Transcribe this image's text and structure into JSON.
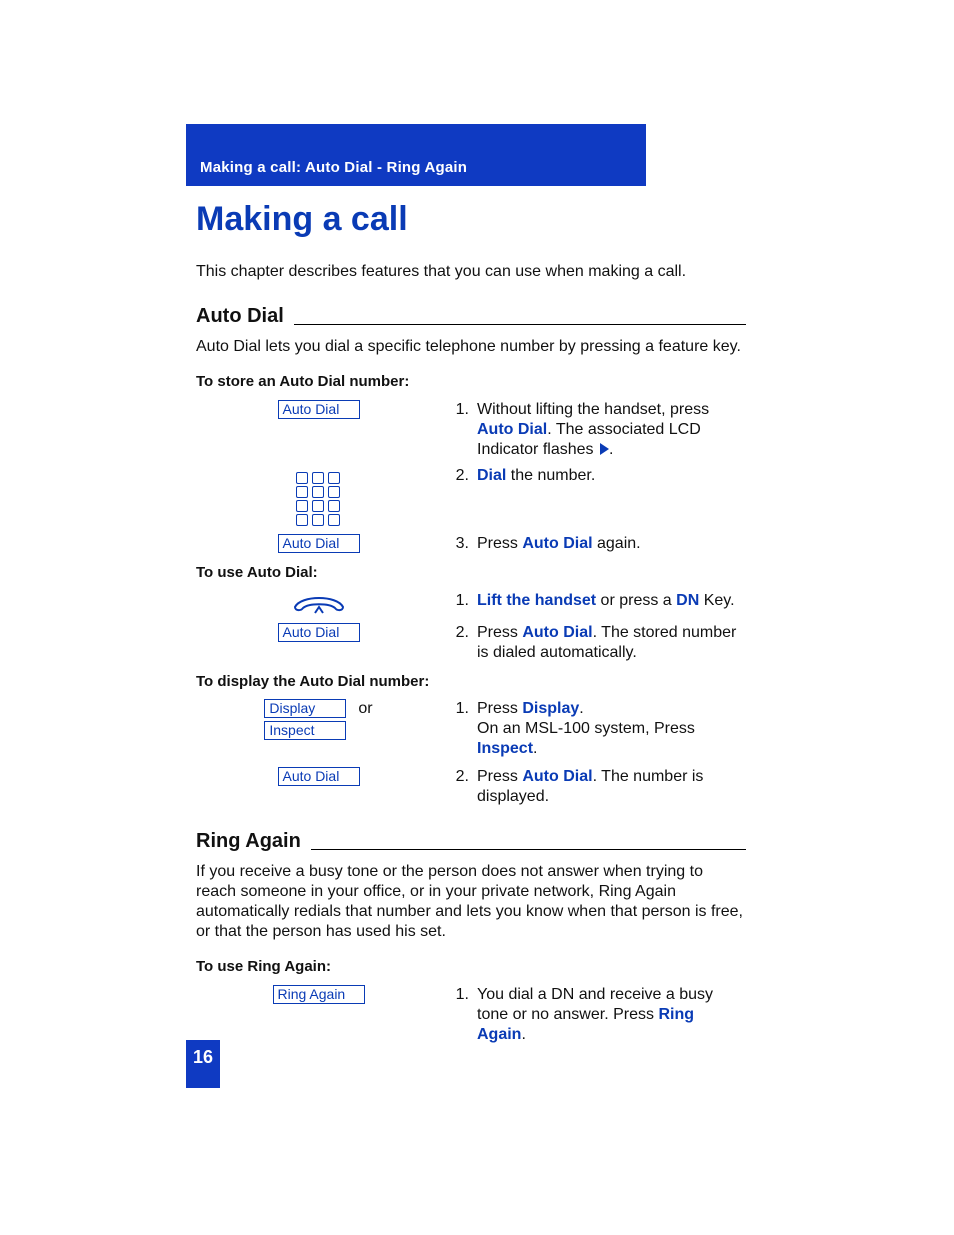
{
  "header": "Making a call: Auto Dial - Ring Again",
  "title": "Making a call",
  "page_number": "16",
  "intro": "This chapter describes features that you can use when making a call.",
  "autodial": {
    "heading": "Auto Dial",
    "desc": "Auto Dial lets you dial a specific telephone number by pressing a feature key.",
    "store": {
      "title": "To store an Auto Dial number:",
      "key1": "Auto Dial",
      "key3": "Auto Dial",
      "s1_a": "Without lifting the handset, press ",
      "s1_b": "Auto Dial",
      "s1_c": ". The associated LCD Indicator flashes ",
      "s1_d": ".",
      "s2_a": "Dial",
      "s2_b": " the number.",
      "s3_a": "Press ",
      "s3_b": "Auto Dial",
      "s3_c": " again."
    },
    "use": {
      "title": "To use Auto Dial:",
      "key2": "Auto Dial",
      "s1_a": "Lift the handset",
      "s1_b": " or press a ",
      "s1_c": "DN",
      "s1_d": " Key.",
      "s2_a": "Press ",
      "s2_b": "Auto Dial",
      "s2_c": ". The stored number is dialed automatically."
    },
    "display": {
      "title": "To display the Auto Dial number:",
      "key1a": "Display",
      "key1b": "Inspect",
      "or": "or",
      "key2": "Auto Dial",
      "s1_a": "Press ",
      "s1_b": "Display",
      "s1_c": ".",
      "s1_d": "On an MSL-100 system, Press ",
      "s1_e": "Inspect",
      "s1_f": ".",
      "s2_a": "Press ",
      "s2_b": "Auto Dial",
      "s2_c": ". The number is displayed."
    }
  },
  "ringagain": {
    "heading": "Ring Again",
    "desc": "If you receive a busy tone or the person does not answer when trying to reach someone in your office, or in your private network, Ring Again automatically redials that number and lets you know when that person is free, or that the person has used his set.",
    "use": {
      "title": "To use Ring Again:",
      "key1": "Ring Again",
      "s1_a": "You dial a DN and receive a busy tone or no answer. Press ",
      "s1_b": "Ring Again",
      "s1_c": "."
    }
  }
}
